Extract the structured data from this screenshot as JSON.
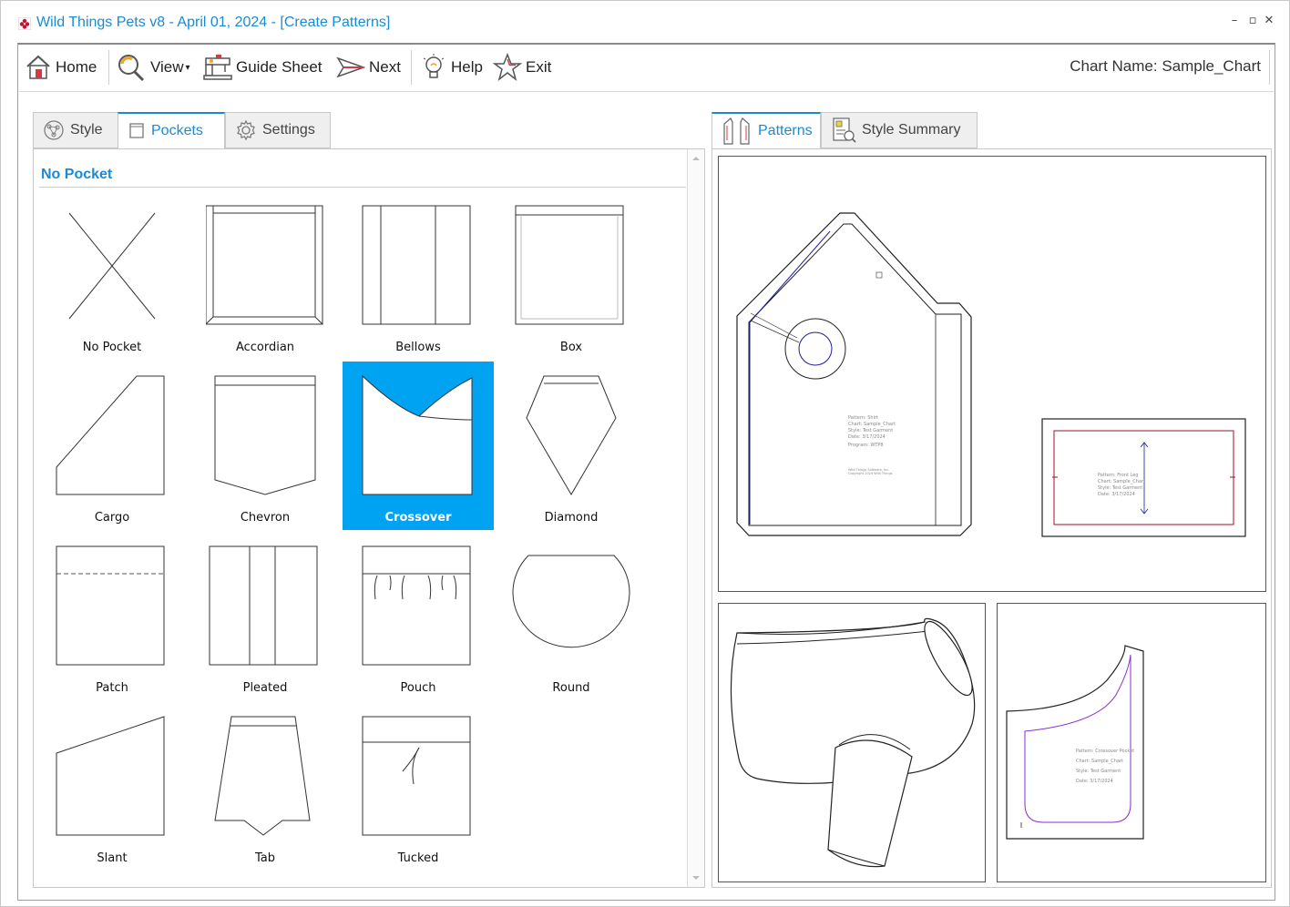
{
  "window": {
    "title": "Wild Things Pets v8 - April 01, 2024 - [Create Patterns]",
    "minimize": "–",
    "maximize": "▫",
    "close": "✕"
  },
  "toolbar": {
    "home": "Home",
    "view": "View",
    "view_arrow": "▾",
    "guide_sheet": "Guide Sheet",
    "next": "Next",
    "help": "Help",
    "exit": "Exit",
    "chart_name": "Chart Name: Sample_Chart"
  },
  "left_tabs": [
    {
      "label": "Style",
      "icon": "style-icon"
    },
    {
      "label": "Pockets",
      "icon": "pocket-icon"
    },
    {
      "label": "Settings",
      "icon": "gear-icon"
    }
  ],
  "left_active_tab": "Pockets",
  "section_title": "No Pocket",
  "pockets": [
    {
      "label": "No Pocket",
      "selected": false
    },
    {
      "label": "Accordian",
      "selected": false
    },
    {
      "label": "Bellows",
      "selected": false
    },
    {
      "label": "Box",
      "selected": false
    },
    {
      "label": "Cargo",
      "selected": false
    },
    {
      "label": "Chevron",
      "selected": false
    },
    {
      "label": "Crossover",
      "selected": true
    },
    {
      "label": "Diamond",
      "selected": false
    },
    {
      "label": "Patch",
      "selected": false
    },
    {
      "label": "Pleated",
      "selected": false
    },
    {
      "label": "Pouch",
      "selected": false
    },
    {
      "label": "Round",
      "selected": false
    },
    {
      "label": "Slant",
      "selected": false
    },
    {
      "label": "Tab",
      "selected": false
    },
    {
      "label": "Tucked",
      "selected": false
    }
  ],
  "right_tabs": [
    {
      "label": "Patterns",
      "icon": "patterns-icon"
    },
    {
      "label": "Style Summary",
      "icon": "style-summary-icon"
    }
  ],
  "right_active_tab": "Patterns",
  "pattern_labels": {
    "shirt": [
      "Pattern: Shirt",
      "Chart: Sample_Chart",
      "Style: Test Garment",
      "Date: 3/17/2024",
      "Program: WTP8"
    ],
    "shirt_copyright": [
      "Wild Things Software, Inc.",
      "Copyright 2024 Wild Things"
    ],
    "front_leg": [
      "Pattern: Front Leg",
      "Chart: Sample_Chart",
      "Style: Test Garment",
      "Date: 3/17/2024"
    ],
    "crossover_pocket": [
      "Pattern: Crossover Pocket",
      "Chart: Sample_Chart",
      "Style: Test Garment",
      "Date: 3/17/2024"
    ]
  },
  "colors": {
    "accent": "#1a8ad4",
    "selected": "#00a2f2",
    "seam_blue": "#1a1aa0",
    "seam_red": "#a0102a",
    "seam_purple": "#8a2bd0"
  }
}
